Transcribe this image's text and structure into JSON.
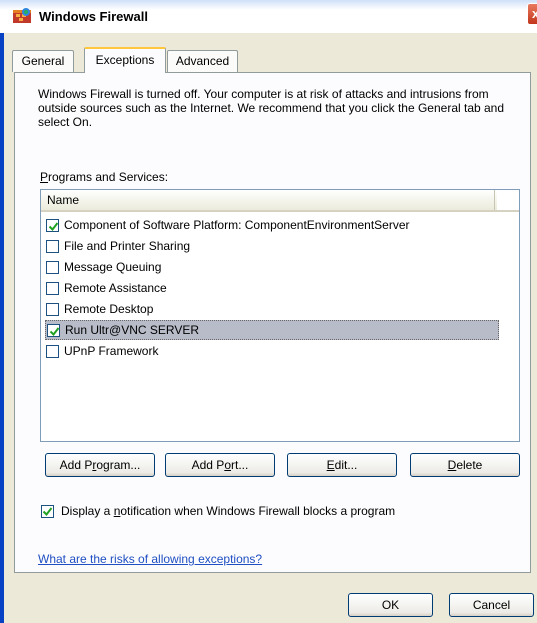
{
  "window": {
    "title": "Windows Firewall",
    "close_label": "x"
  },
  "tabs": [
    {
      "label": "General",
      "active": false
    },
    {
      "label": "Exceptions",
      "active": true
    },
    {
      "label": "Advanced",
      "active": false
    }
  ],
  "intro_text": "Windows Firewall is turned off. Your computer is at risk of attacks and intrusions from outside sources such as the Internet. We recommend that you click the General tab and select On.",
  "programs": {
    "section_label_prefix": "P",
    "section_label_rest": "rograms and Services:",
    "column_header": "Name",
    "items": [
      {
        "label": "Component of Software Platform: ComponentEnvironmentServer",
        "checked": true,
        "selected": false
      },
      {
        "label": "File and Printer Sharing",
        "checked": false,
        "selected": false
      },
      {
        "label": "Message Queuing",
        "checked": false,
        "selected": false
      },
      {
        "label": "Remote Assistance",
        "checked": false,
        "selected": false
      },
      {
        "label": "Remote Desktop",
        "checked": false,
        "selected": false
      },
      {
        "label": "Run Ultr@VNC SERVER",
        "checked": true,
        "selected": true
      },
      {
        "label": "UPnP Framework",
        "checked": false,
        "selected": false
      }
    ]
  },
  "buttons": {
    "add_program_a": "Add P",
    "add_program_b": "r",
    "add_program_c": "ogram...",
    "add_port_a": "Add P",
    "add_port_b": "o",
    "add_port_c": "rt...",
    "edit_a": "E",
    "edit_b": "dit...",
    "delete_a": "D",
    "delete_b": "elete",
    "ok": "OK",
    "cancel": "Cancel"
  },
  "notification": {
    "checked": true,
    "label_a": "Display a ",
    "label_b": "n",
    "label_c": "otification when Windows Firewall blocks a program"
  },
  "help_link": "What are the risks of allowing exceptions?",
  "colors": {
    "dialog_face": "#ece9d8",
    "tab_highlight": "#ffc83c",
    "selection": "#b8bcc8",
    "link": "#1f4fc2",
    "checkmark": "#21a121"
  }
}
